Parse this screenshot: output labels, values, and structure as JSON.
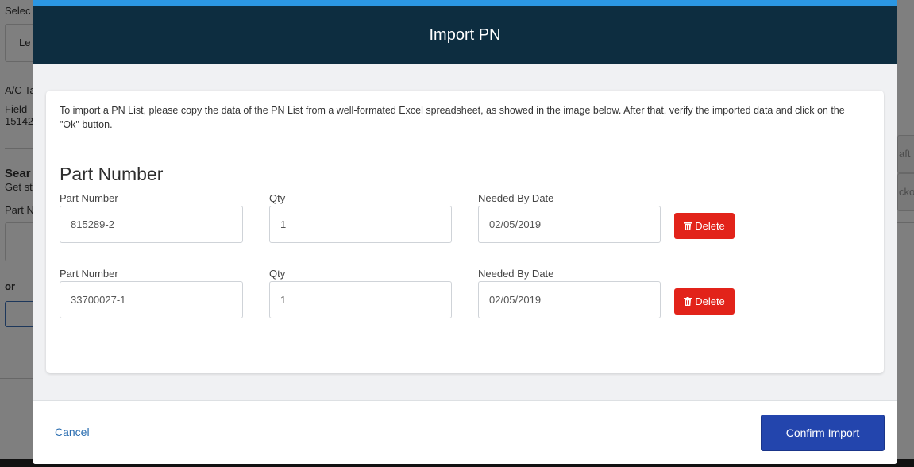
{
  "background": {
    "fragments": [
      {
        "text": "Selec"
      },
      {
        "text": "Le"
      },
      {
        "text": "A/C Ta"
      },
      {
        "text": "Field"
      },
      {
        "text": "15142"
      },
      {
        "text": "Sear"
      },
      {
        "text": "Get st"
      },
      {
        "text": "Part N"
      },
      {
        "text": "or"
      },
      {
        "text": "aft"
      },
      {
        "text": "cko"
      }
    ]
  },
  "modal": {
    "title": "Import PN",
    "instructions": "To import a PN List, please copy the data of the PN List from a well-formated Excel spreadsheet, as showed in the image below. After that, verify the imported data and click on the \"Ok\" button.",
    "section_title": "Part Number",
    "rows": [
      {
        "part_label": "Part Number",
        "part_value": "815289-2",
        "qty_label": "Qty",
        "qty_value": "1",
        "date_label": "Needed By Date",
        "date_value": "02/05/2019",
        "delete_label": "Delete"
      },
      {
        "part_label": "Part Number",
        "part_value": "33700027-1",
        "qty_label": "Qty",
        "qty_value": "1",
        "date_label": "Needed By Date",
        "date_value": "02/05/2019",
        "delete_label": "Delete"
      }
    ],
    "footer": {
      "cancel_label": "Cancel",
      "confirm_label": "Confirm Import"
    }
  },
  "colors": {
    "header_bg": "#0d2d40",
    "accent": "#2b97e3",
    "delete_red": "#e2231a",
    "confirm_blue": "#2345ad",
    "link_blue": "#2a6db0"
  }
}
